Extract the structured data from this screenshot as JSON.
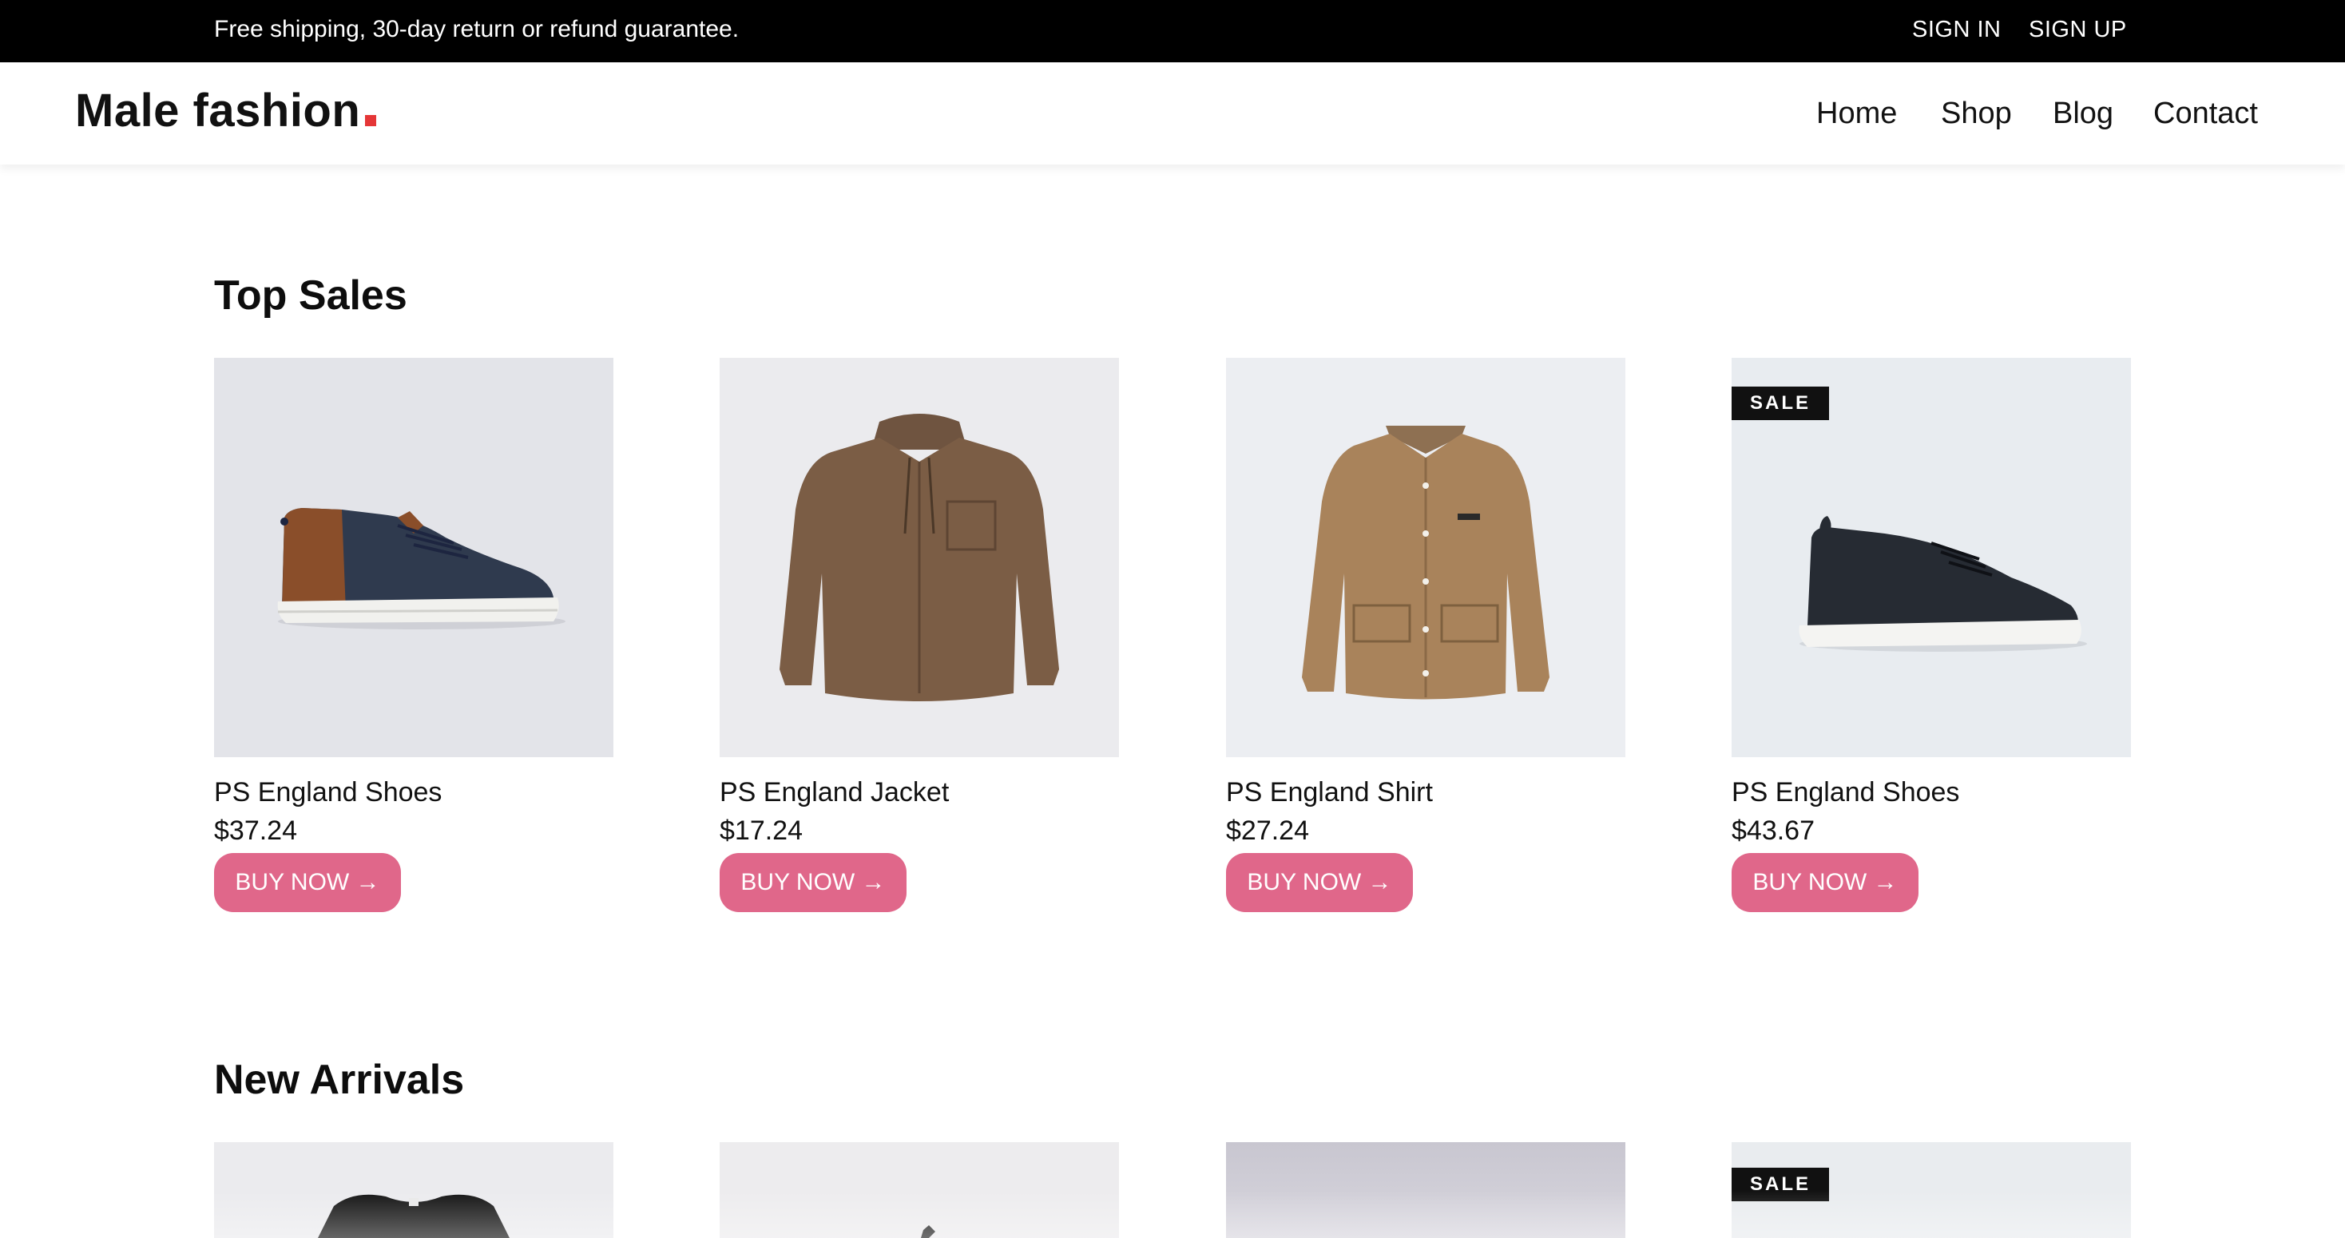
{
  "topbar": {
    "announcement": "Free shipping, 30-day return or refund guarantee.",
    "sign_in": "SIGN IN",
    "sign_up": "SIGN UP"
  },
  "header": {
    "logo_text": "Male fashion",
    "nav": [
      "Home",
      "Shop",
      "Blog",
      "Contact"
    ]
  },
  "sections": {
    "top_sales_title": "Top Sales",
    "new_arrivals_title": "New Arrivals"
  },
  "top_sales": [
    {
      "name": "PS England Shoes",
      "price": "$37.24",
      "button": "BUY NOW →",
      "sale": false,
      "image": "sneaker-navy-brown"
    },
    {
      "name": "PS England Jacket",
      "price": "$17.24",
      "button": "BUY NOW →",
      "sale": false,
      "image": "hooded-jacket-brown"
    },
    {
      "name": "PS England Shirt",
      "price": "$27.24",
      "button": "BUY NOW →",
      "sale": false,
      "image": "overshirt-tan"
    },
    {
      "name": "PS England Shoes",
      "price": "$43.67",
      "button": "BUY NOW →",
      "sale": true,
      "sale_label": "SALE",
      "image": "sneaker-black"
    }
  ],
  "new_arrivals": [
    {
      "sale": false,
      "image": "black-sweater"
    },
    {
      "sale": false,
      "image": "grey-item"
    },
    {
      "sale": false,
      "image": "lavender-item"
    },
    {
      "sale": true,
      "sale_label": "SALE",
      "image": "light-item"
    }
  ],
  "colors": {
    "topbar_bg": "#000000",
    "button_bg": "#e0678a",
    "logo_accent": "#e53637",
    "sale_badge_bg": "#111111"
  }
}
